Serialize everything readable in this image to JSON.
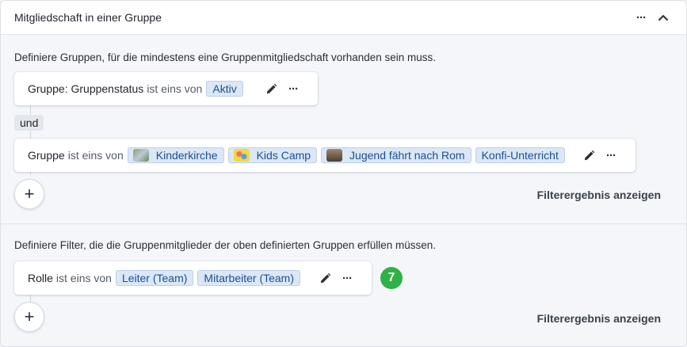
{
  "panel": {
    "title": "Mitgliedschaft in einer Gruppe"
  },
  "groups_section": {
    "description": "Definiere Gruppen, für die mindestens eine Gruppenmitgliedschaft vorhanden sein muss.",
    "filter1": {
      "field": "Gruppe: Gruppenstatus",
      "operator": "ist eins von",
      "values": [
        "Aktiv"
      ]
    },
    "conjunction": "und",
    "filter2": {
      "field": "Gruppe",
      "operator": "ist eins von",
      "values": [
        "Kinderkirche",
        "Kids Camp",
        "Jugend fährt nach Rom",
        "Konfi-Unterricht"
      ]
    },
    "add_label": "+",
    "result_link": "Filterergebnis anzeigen"
  },
  "members_section": {
    "description": "Definiere Filter, die die Gruppenmitglieder der oben definierten Gruppen erfüllen müssen.",
    "filter1": {
      "field": "Rolle",
      "operator": "ist eins von",
      "values": [
        "Leiter (Team)",
        "Mitarbeiter (Team)"
      ]
    },
    "count_badge": "7",
    "add_label": "+",
    "result_link": "Filterergebnis anzeigen"
  },
  "colors": {
    "accent_tag_bg": "#dbe7f7",
    "accent_tag_text": "#1d4f8f",
    "badge_green": "#2fb145"
  },
  "icons": {
    "header_more": "more-horizontal-icon",
    "header_collapse": "chevron-up-icon",
    "edit": "pencil-icon",
    "more": "more-horizontal-icon"
  }
}
